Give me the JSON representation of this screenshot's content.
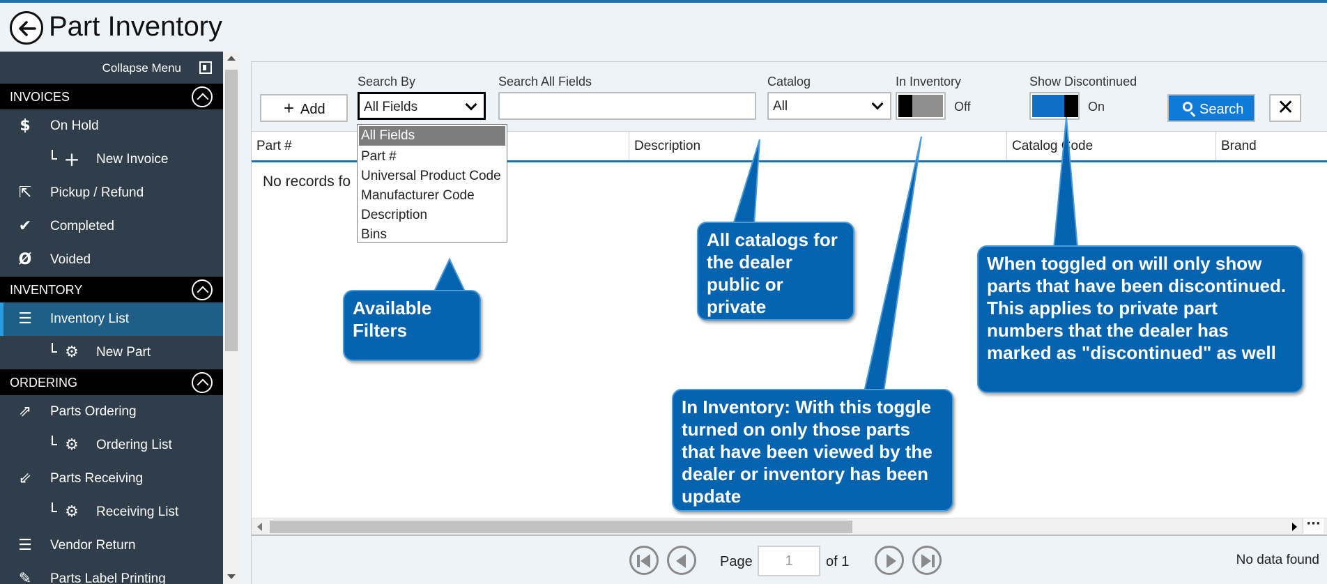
{
  "header": {
    "title": "Part Inventory",
    "back_icon": "back-arrow-icon"
  },
  "sidebar": {
    "collapse_label": "Collapse Menu",
    "sections": [
      {
        "label": "INVOICES",
        "items": [
          {
            "label": "On Hold",
            "icon": "dollar-icon",
            "sub": false
          },
          {
            "label": "New Invoice",
            "icon": "plus-icon",
            "sub": true
          },
          {
            "label": "Pickup / Refund",
            "icon": "refund-icon",
            "sub": false
          },
          {
            "label": "Completed",
            "icon": "check-icon",
            "sub": false
          },
          {
            "label": "Voided",
            "icon": "void-icon",
            "sub": false
          }
        ]
      },
      {
        "label": "INVENTORY",
        "items": [
          {
            "label": "Inventory List",
            "icon": "list-icon",
            "sub": false,
            "active": true
          },
          {
            "label": "New Part",
            "icon": "gears-icon",
            "sub": true
          }
        ]
      },
      {
        "label": "ORDERING",
        "items": [
          {
            "label": "Parts Ordering",
            "icon": "order-icon",
            "sub": false
          },
          {
            "label": "Ordering List",
            "icon": "gears-icon",
            "sub": true
          },
          {
            "label": "Parts Receiving",
            "icon": "receive-icon",
            "sub": false
          },
          {
            "label": "Receiving List",
            "icon": "gears-icon",
            "sub": true
          },
          {
            "label": "Vendor Return",
            "icon": "list-icon",
            "sub": false
          },
          {
            "label": "Parts Label Printing",
            "icon": "label-icon",
            "sub": false
          }
        ]
      }
    ]
  },
  "toolbar": {
    "add_label": "Add",
    "search_by_label": "Search By",
    "search_by_value": "All Fields",
    "search_all_label": "Search All Fields",
    "search_all_value": "",
    "catalog_label": "Catalog",
    "catalog_value": "All",
    "in_inventory_label": "In Inventory",
    "in_inventory_state": "Off",
    "show_discontinued_label": "Show Discontinued",
    "show_discontinued_state": "On",
    "search_label": "Search",
    "toggle_on_color": "#0f6fc6",
    "toggle_off_color": "#8f8f8f"
  },
  "search_by_options": [
    "All Fields",
    "Part #",
    "Universal Product Code",
    "Manufacturer Code",
    "Description",
    "Bins"
  ],
  "grid": {
    "columns": [
      "Part #",
      "Description",
      "Catalog Code",
      "Brand"
    ],
    "empty_message": "No records fo"
  },
  "pager": {
    "page_label": "Page",
    "page_value": "1",
    "of_label": "of 1",
    "status": "No data found"
  },
  "callouts": [
    "Available Filters",
    "All catalogs for the dealer public or private",
    "In Inventory: With this toggle turned on only those parts that have been viewed by the dealer or inventory  has been update",
    "When toggled on will only show parts that have been discontinued.  This applies to private part numbers that the dealer has marked as \"discontinued\" as well"
  ],
  "colors": {
    "accent": "#1f6fb3",
    "sidebar_bg": "#2f3e4a",
    "callout_bg": "#0563b0",
    "search_btn": "#0f7ad8"
  }
}
